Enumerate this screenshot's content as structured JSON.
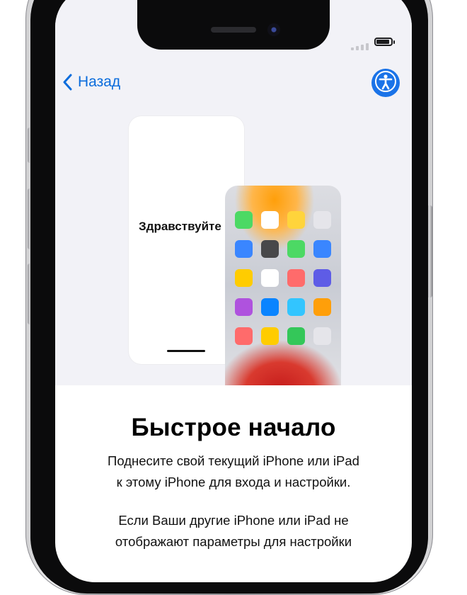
{
  "nav": {
    "back_label": "Назад"
  },
  "illustration": {
    "greeting": "Здравствуйте",
    "app_colors": [
      "#4cd964",
      "#ffffff",
      "#ffd43b",
      "#e5e5ea",
      "#3a86ff",
      "#48484a",
      "#4cd964",
      "#3a86ff",
      "#ffcc00",
      "#ffffff",
      "#ff6b6b",
      "#5e5ce6",
      "#af52de",
      "#0a84ff",
      "#32c5ff",
      "#ff9f0a",
      "#ff6b6b",
      "#ffcc00",
      "#34c759",
      "#e5e5ea"
    ]
  },
  "content": {
    "title": "Быстрое начало",
    "line1": "Поднесите свой текущий iPhone или iPad",
    "line2": "к этому iPhone для входа и настройки.",
    "line3": "Если Ваши другие iPhone или iPad не",
    "line4": "отображают параметры для настройки"
  },
  "colors": {
    "accent": "#0a6cdc",
    "accessibility_button": "#1a73e8",
    "top_background": "#f2f2f7"
  },
  "icons": [
    "chevron-left-icon",
    "accessibility-icon",
    "signal-icon",
    "battery-icon"
  ]
}
